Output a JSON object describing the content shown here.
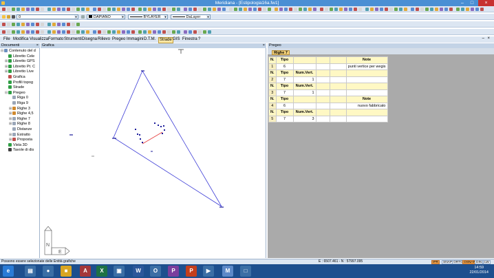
{
  "window": {
    "title": "Meridiana - [Estipologia16a.fw1]"
  },
  "toolbar": {
    "layer_value": "0",
    "color_name": "DAPIANO",
    "linetype_value": "BYLAYER",
    "linestyle_value": "DaLayer"
  },
  "menu": {
    "items": [
      "File",
      "Modifica",
      "Visualizza",
      "Formato",
      "Strumenti",
      "Disegna",
      "Rilievo",
      "Pregeo",
      "Immagini",
      "D.T.M.",
      "Strade",
      "GIS",
      "Finestra",
      "?"
    ],
    "active": "Strade"
  },
  "panels": {
    "documents_title": "Documenti",
    "graphics_title": "Grafica",
    "pregeo_title": "Pregeo",
    "close_symbol": "×"
  },
  "tree": {
    "items": [
      {
        "label": "Contenuto del d",
        "indent": 0,
        "pm": "⊟",
        "color": "#6b8fbf"
      },
      {
        "label": "Libretto Cele",
        "indent": 1,
        "pm": "",
        "color": "#2f9e44"
      },
      {
        "label": "Libretto GPS",
        "indent": 1,
        "pm": "⊞",
        "color": "#2f9e44"
      },
      {
        "label": "Libretto Pt. C",
        "indent": 1,
        "pm": "⊞",
        "color": "#2f9e44"
      },
      {
        "label": "Libretto Live",
        "indent": 1,
        "pm": "⊞",
        "color": "#2f9e44"
      },
      {
        "label": "Grafica",
        "indent": 1,
        "pm": "",
        "color": "#c0504d"
      },
      {
        "label": "Profili topog",
        "indent": 1,
        "pm": "",
        "color": "#2f9e44"
      },
      {
        "label": "Strade",
        "indent": 1,
        "pm": "",
        "color": "#2f9e44"
      },
      {
        "label": "Pregeo",
        "indent": 1,
        "pm": "⊟",
        "color": "#2f9e44"
      },
      {
        "label": "Riga 0",
        "indent": 2,
        "pm": "",
        "color": "#9aa6b8"
      },
      {
        "label": "Riga 9",
        "indent": 2,
        "pm": "",
        "color": "#9aa6b8"
      },
      {
        "label": "Righe 3",
        "indent": 2,
        "pm": "⊞",
        "color": "#d08a2f"
      },
      {
        "label": "Righe 4,5",
        "indent": 2,
        "pm": "⊞",
        "color": "#d08a2f"
      },
      {
        "label": "Righe 7",
        "indent": 2,
        "pm": "⊞",
        "color": "#9aa6b8"
      },
      {
        "label": "Righe 8",
        "indent": 2,
        "pm": "⊞",
        "color": "#9aa6b8"
      },
      {
        "label": "Distanze",
        "indent": 2,
        "pm": "",
        "color": "#9aa6b8"
      },
      {
        "label": "Estratto",
        "indent": 2,
        "pm": "⊞",
        "color": "#9aa6b8"
      },
      {
        "label": "Proposta",
        "indent": 2,
        "pm": "⊞",
        "color": "#c0504d"
      },
      {
        "label": "Vista 3D",
        "indent": 1,
        "pm": "",
        "color": "#2f9e44"
      },
      {
        "label": "Tavole di dis",
        "indent": 1,
        "pm": "",
        "color": "#404040"
      }
    ]
  },
  "pregeo": {
    "tab_label": "Righe 7",
    "rows": [
      {
        "kind": "header",
        "cells": [
          "N.",
          "Tipo",
          "",
          "",
          "",
          "Note"
        ]
      },
      {
        "kind": "data",
        "cells": [
          "1",
          "6",
          "",
          "",
          "",
          "punti vertice per wegis"
        ]
      },
      {
        "kind": "header",
        "cells": [
          "N.",
          "Tipo",
          "Num.Vert.",
          "",
          "",
          ""
        ]
      },
      {
        "kind": "data",
        "cells": [
          "2",
          "7",
          "1",
          "",
          "",
          ""
        ]
      },
      {
        "kind": "header",
        "cells": [
          "N.",
          "Tipo",
          "Num.Vert.",
          "",
          "",
          ""
        ]
      },
      {
        "kind": "data",
        "cells": [
          "3",
          "7",
          "1",
          "",
          "",
          ""
        ]
      },
      {
        "kind": "header",
        "cells": [
          "N.",
          "Tipo",
          "",
          "",
          "",
          "Note"
        ]
      },
      {
        "kind": "data",
        "cells": [
          "4",
          "6",
          "",
          "",
          "",
          "nuovo fabbricato"
        ]
      },
      {
        "kind": "header",
        "cells": [
          "N.",
          "Tipo",
          "Num.Vert.",
          "",
          "",
          ""
        ]
      },
      {
        "kind": "data",
        "cells": [
          "5",
          "7",
          "3",
          "",
          "",
          ""
        ]
      }
    ]
  },
  "compass": {
    "n": "N",
    "e": "E"
  },
  "status": {
    "message": "Possono essere selezionate delle Entità grafiche",
    "coords": "E : 6507.461 - N : 57997.095",
    "snaps": [
      {
        "label": "IPR",
        "on": true
      },
      {
        "label": "SNAP",
        "on": false
      },
      {
        "label": "ORTO",
        "on": false
      },
      {
        "label": "OSNAP",
        "on": true
      },
      {
        "label": "DIN",
        "on": false
      },
      {
        "label": "LW",
        "on": false
      }
    ]
  },
  "taskbar": {
    "time": "14:59",
    "date": "22/01/2014",
    "apps": [
      {
        "name": "ie-icon",
        "glyph": "e",
        "color": "#2a7bd6"
      },
      {
        "name": "explorer-icon",
        "glyph": "▤",
        "color": "#3b6ea5"
      },
      {
        "name": "chrome-icon",
        "glyph": "●",
        "color": "#3b6ea5"
      },
      {
        "name": "folder-icon",
        "glyph": "■",
        "color": "#d9a521"
      },
      {
        "name": "access-icon",
        "glyph": "A",
        "color": "#a4373a"
      },
      {
        "name": "excel-icon",
        "glyph": "X",
        "color": "#1e7145"
      },
      {
        "name": "app-icon",
        "glyph": "▣",
        "color": "#3b6ea5"
      },
      {
        "name": "word-icon",
        "glyph": "W",
        "color": "#2b579a"
      },
      {
        "name": "outlook-icon",
        "glyph": "O",
        "color": "#3b6ea5"
      },
      {
        "name": "pregeo-icon",
        "glyph": "P",
        "color": "#7a3e9d"
      },
      {
        "name": "powerpoint-icon",
        "glyph": "P",
        "color": "#c43e1c"
      },
      {
        "name": "media-icon",
        "glyph": "▶",
        "color": "#3b6ea5"
      },
      {
        "name": "meridiana-icon",
        "glyph": "M",
        "color": "#5d89c8"
      },
      {
        "name": "notes-icon",
        "glyph": "□",
        "color": "#3b6ea5"
      }
    ]
  }
}
